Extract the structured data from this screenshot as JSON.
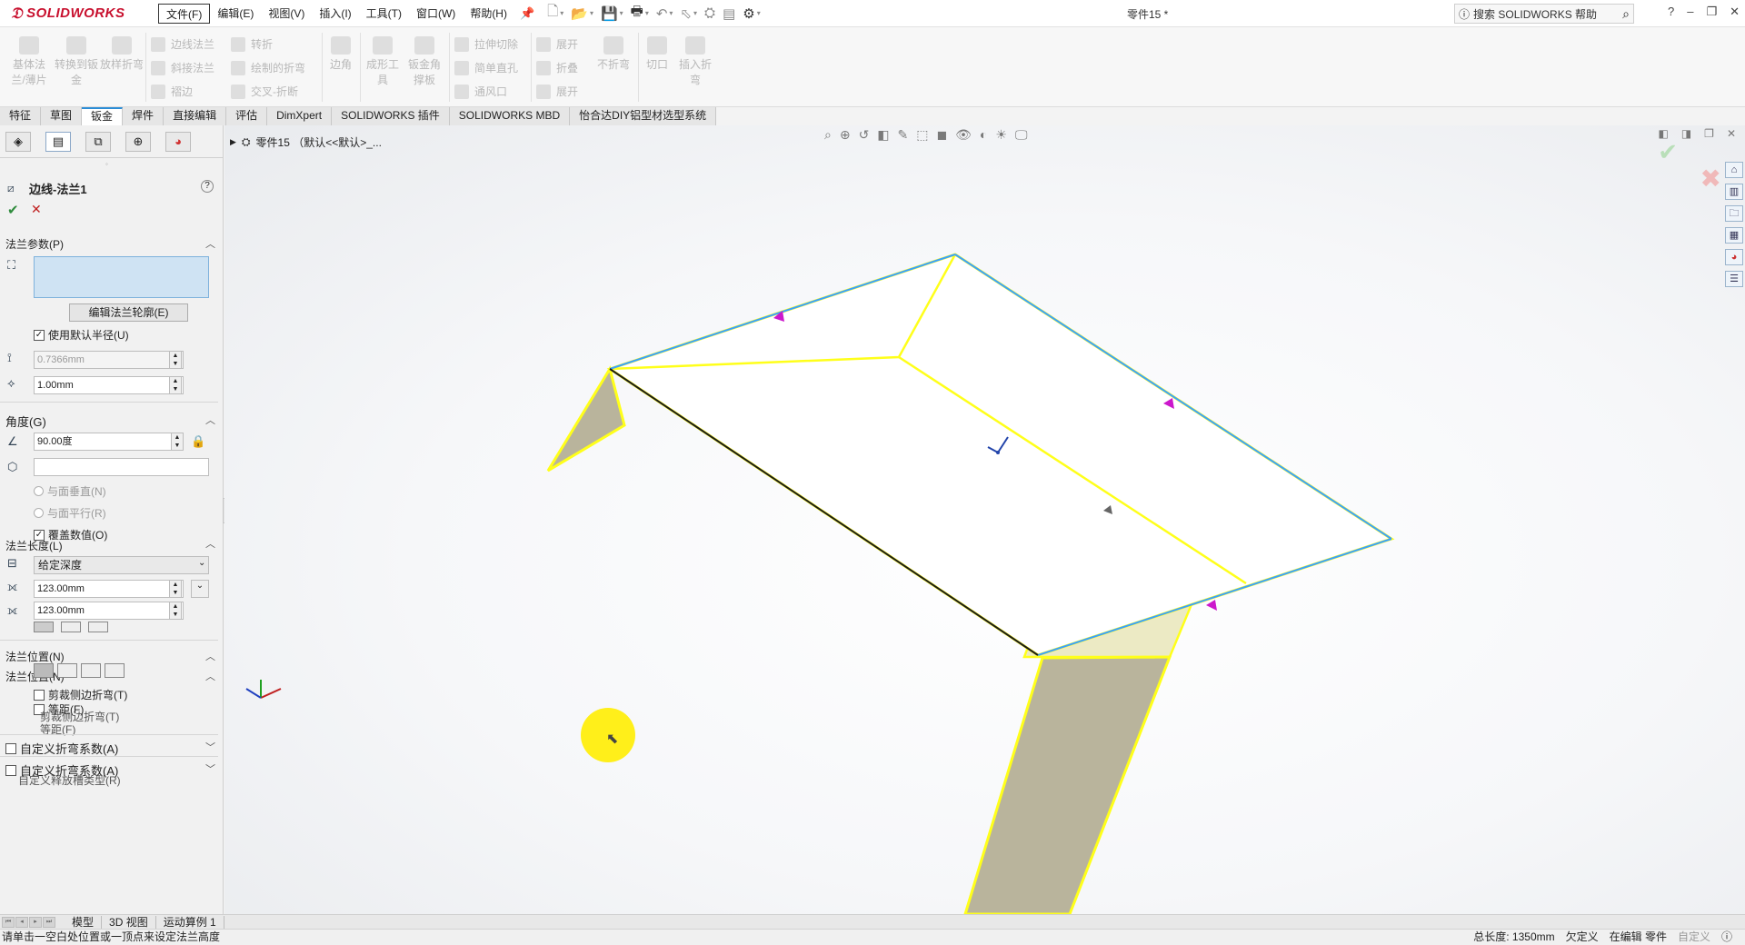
{
  "app": {
    "logo": "SOLIDWORKS",
    "doc_title": "零件15 *",
    "menu": [
      "文件(F)",
      "编辑(E)",
      "视图(V)",
      "插入(I)",
      "工具(T)",
      "窗口(W)",
      "帮助(H)"
    ],
    "search_label": "搜索 SOLIDWORKS 帮助",
    "help_symbol": "?",
    "window_controls": [
      "–",
      "❐",
      "✕"
    ]
  },
  "ribbon": {
    "big": [
      "基体法兰/薄片",
      "转换到钣金",
      "放样折弯",
      "边角",
      "成形工具",
      "钣金角撑板",
      "不折弯",
      "切口",
      "插入折弯"
    ],
    "small": [
      "边线法兰",
      "斜接法兰",
      "褶边",
      "转折",
      "绘制的折弯",
      "交叉-折断",
      "拉伸切除",
      "简单直孔",
      "通风口",
      "展开",
      "折叠",
      "展开"
    ]
  },
  "tabs": [
    "特征",
    "草图",
    "钣金",
    "焊件",
    "直接编辑",
    "评估",
    "DimXpert",
    "SOLIDWORKS 插件",
    "SOLIDWORKS MBD",
    "怡合达DIY铝型材选型系统"
  ],
  "active_tab": "钣金",
  "property_manager": {
    "title": "边线-法兰1",
    "flange_params": "法兰参数(P)",
    "edit_profile": "编辑法兰轮廓(E)",
    "use_default_radius": "使用默认半径(U)",
    "radius_value": "0.7366mm",
    "gap_value": "1.00mm",
    "angle_header": "角度(G)",
    "angle_value": "90.00度",
    "radio_perpendicular": "与面垂直(N)",
    "radio_parallel": "与面平行(R)",
    "override_value": "覆盖数值(O)",
    "length_header_ghost": "法兰长度(L)",
    "length_condition": "给定深度",
    "length_value_1": "123.00mm",
    "length_value_2": "123.00mm",
    "position_header_ghost": "法兰位置(N)",
    "position_header_ghost2": "法兰位置(N)",
    "trim_side_bends_ghost": "剪裁侧边折弯(T)",
    "trim_side_bends_ghost2": "剪裁侧边折弯(T)",
    "offset_ghost": "等距(F)",
    "offset_ghost2": "等距(F)",
    "custom_bend_allowance": "自定义折弯系数(A)",
    "custom_bend_allowance2": "自定义折弯系数(A)",
    "custom_relief_ghost": "自定义释放槽类型(R)"
  },
  "viewport": {
    "tree_label": "零件15 （默认<<默认>_...",
    "colors": {
      "edge_highlight": "#ffff1a",
      "selected_edge": "#3aa0ff",
      "flange_face": "#b9b49c",
      "arrow": "#cc18cc"
    }
  },
  "bottom_tabs": [
    "模型",
    "3D 视图",
    "运动算例 1"
  ],
  "status": {
    "message": "请单击一空白处位置或一顶点来设定法兰高度",
    "total_length": "总长度: 1350mm",
    "defined": "欠定义",
    "editing": "在编辑 零件",
    "custom": "自定义"
  }
}
